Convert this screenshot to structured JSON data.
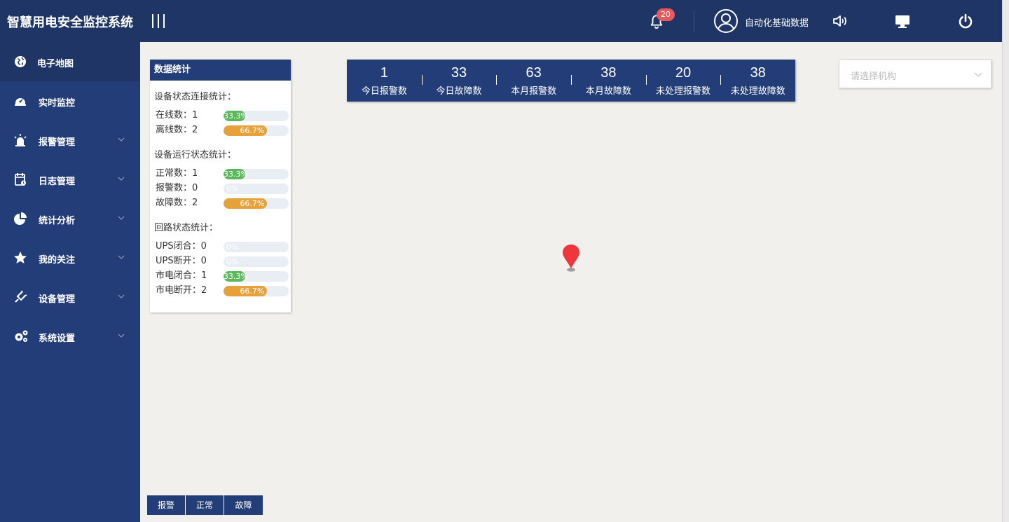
{
  "header": {
    "app_title": "智慧用电安全监控系统",
    "notification_count": "20",
    "username": "自动化基础数据",
    "icons": [
      "menu-toggle-icon",
      "bell-icon",
      "user-avatar-icon",
      "speaker-icon",
      "monitor-icon",
      "power-icon"
    ]
  },
  "sidebar": {
    "items": [
      {
        "label": "电子地图",
        "icon": "globe-icon",
        "active": true,
        "has_children": false
      },
      {
        "label": "实时监控",
        "icon": "monitor-dashboard-icon",
        "active": false,
        "has_children": false
      },
      {
        "label": "报警管理",
        "icon": "alarm-light-icon",
        "active": false,
        "has_children": true
      },
      {
        "label": "日志管理",
        "icon": "calendar-log-icon",
        "active": false,
        "has_children": true
      },
      {
        "label": "统计分析",
        "icon": "pie-chart-icon",
        "active": false,
        "has_children": true
      },
      {
        "label": "我的关注",
        "icon": "star-icon",
        "active": false,
        "has_children": true
      },
      {
        "label": "设备管理",
        "icon": "plug-icon",
        "active": false,
        "has_children": true
      },
      {
        "label": "系统设置",
        "icon": "gears-icon",
        "active": false,
        "has_children": true
      }
    ]
  },
  "stats": {
    "title": "数据统计",
    "groups": [
      {
        "title": "设备状态连接统计：",
        "rows": [
          {
            "label": "在线数：1",
            "percent_text": "33.3%",
            "fraction": 0.333,
            "color": "#5cb85c"
          },
          {
            "label": "离线数：2",
            "percent_text": "66.7%",
            "fraction": 0.667,
            "color": "#e7a13a"
          }
        ]
      },
      {
        "title": "设备运行状态统计：",
        "rows": [
          {
            "label": "正常数：1",
            "percent_text": "33.3%",
            "fraction": 0.333,
            "color": "#5cb85c"
          },
          {
            "label": "报警数：0",
            "percent_text": "0%",
            "fraction": 0,
            "color": "#e9edf4"
          },
          {
            "label": "故障数：2",
            "percent_text": "66.7%",
            "fraction": 0.667,
            "color": "#e7a13a"
          }
        ]
      },
      {
        "title": "回路状态统计：",
        "rows": [
          {
            "label": "UPS闭合：0",
            "percent_text": "0%",
            "fraction": 0,
            "color": "#e9edf4"
          },
          {
            "label": "UPS断开：0",
            "percent_text": "0%",
            "fraction": 0,
            "color": "#e9edf4"
          },
          {
            "label": "市电闭合：1",
            "percent_text": "33.3%",
            "fraction": 0.333,
            "color": "#5cb85c"
          },
          {
            "label": "市电断开：2",
            "percent_text": "66.7%",
            "fraction": 0.667,
            "color": "#e7a13a"
          }
        ]
      }
    ]
  },
  "counters": [
    {
      "value": "1",
      "label": "今日报警数"
    },
    {
      "value": "33",
      "label": "今日故障数"
    },
    {
      "value": "63",
      "label": "本月报警数"
    },
    {
      "value": "38",
      "label": "本月故障数"
    },
    {
      "value": "20",
      "label": "未处理报警数"
    },
    {
      "value": "38",
      "label": "未处理故障数"
    }
  ],
  "org_select": {
    "placeholder": "请选择机构"
  },
  "map": {
    "marker_icon": "map-pin-icon",
    "marker_color": "#f0353b"
  },
  "legend": {
    "buttons": [
      {
        "label": "报警"
      },
      {
        "label": "正常"
      },
      {
        "label": "故障"
      }
    ]
  },
  "colors": {
    "header_bg": "#1e3566",
    "sidebar_bg": "#233d79",
    "map_bg": "#f1f0ed",
    "green": "#5cb85c",
    "orange": "#e7a13a",
    "badge": "#e9585b"
  }
}
